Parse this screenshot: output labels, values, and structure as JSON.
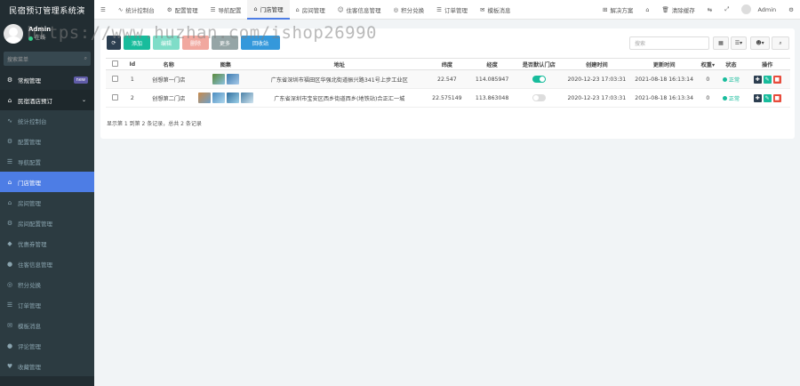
{
  "app": {
    "title": "民宿预订管理系统演"
  },
  "user": {
    "name": "Admin",
    "status": "在线"
  },
  "sidebar": {
    "search_placeholder": "搜索菜单",
    "items": [
      {
        "label": "常规管理",
        "icon": "gear-icon",
        "badge": "new"
      },
      {
        "label": "民宿酒店预订",
        "icon": "home-icon"
      },
      {
        "label": "统计控制台",
        "icon": "chart-icon"
      },
      {
        "label": "配置管理",
        "icon": "cog-icon"
      },
      {
        "label": "导航配置",
        "icon": "list-icon"
      },
      {
        "label": "门店管理",
        "icon": "bank-icon"
      },
      {
        "label": "房间管理",
        "icon": "home-icon"
      },
      {
        "label": "房间配置管理",
        "icon": "cog-icon"
      },
      {
        "label": "优惠券管理",
        "icon": "tag-icon"
      },
      {
        "label": "住客信息管理",
        "icon": "user-icon"
      },
      {
        "label": "积分兑换",
        "icon": "coin-icon"
      },
      {
        "label": "订单管理",
        "icon": "list-icon"
      },
      {
        "label": "模板消息",
        "icon": "mail-icon"
      },
      {
        "label": "评论管理",
        "icon": "comment-icon"
      },
      {
        "label": "收藏管理",
        "icon": "heart-icon"
      }
    ]
  },
  "topbar": {
    "tabs": [
      {
        "label": "统计控制台"
      },
      {
        "label": "配置管理"
      },
      {
        "label": "导航配置"
      },
      {
        "label": "门店管理"
      },
      {
        "label": "房间管理"
      },
      {
        "label": "住客信息管理"
      },
      {
        "label": "积分兑换"
      },
      {
        "label": "订单管理"
      },
      {
        "label": "模板消息"
      }
    ],
    "right": {
      "solution": "解决方案",
      "clear_cache": "清除缓存",
      "user": "Admin"
    }
  },
  "watermark": "https://www.huzhan.com/ishop26990",
  "toolbar": {
    "refresh": "⟳",
    "add": "添加",
    "edit": "编辑",
    "delete": "删除",
    "more": "更多",
    "recycle": "回收站",
    "search_placeholder": "搜索"
  },
  "table": {
    "headers": [
      "",
      "Id",
      "名称",
      "图集",
      "地址",
      "纬度",
      "经度",
      "是否默认门店",
      "创建时间",
      "更新时间",
      "权重",
      "状态",
      "操作"
    ],
    "rows": [
      {
        "id": "1",
        "name": "创想第一门店",
        "address": "广东省深圳市福田区华强北街道振兴路341号上步工业区",
        "lat": "22.547",
        "lng": "114.085947",
        "default": true,
        "created": "2020-12-23 17:03:31",
        "updated": "2021-08-18 16:13:14",
        "weight": "0",
        "status": "正常"
      },
      {
        "id": "2",
        "name": "创想第二门店",
        "address": "广东省深圳市宝安区西乡街道西乡(地铁站)合正汇一城",
        "lat": "22.575149",
        "lng": "113.863048",
        "default": false,
        "created": "2020-12-23 17:03:31",
        "updated": "2021-08-18 16:13:34",
        "weight": "0",
        "status": "正常"
      }
    ],
    "footer": "显示第 1 到第 2 条记录，总共 2 条记录"
  },
  "colors": {
    "accent": "#4d7de5",
    "success": "#18bc9c",
    "danger": "#e74c3c",
    "sidebar": "#222d32"
  }
}
